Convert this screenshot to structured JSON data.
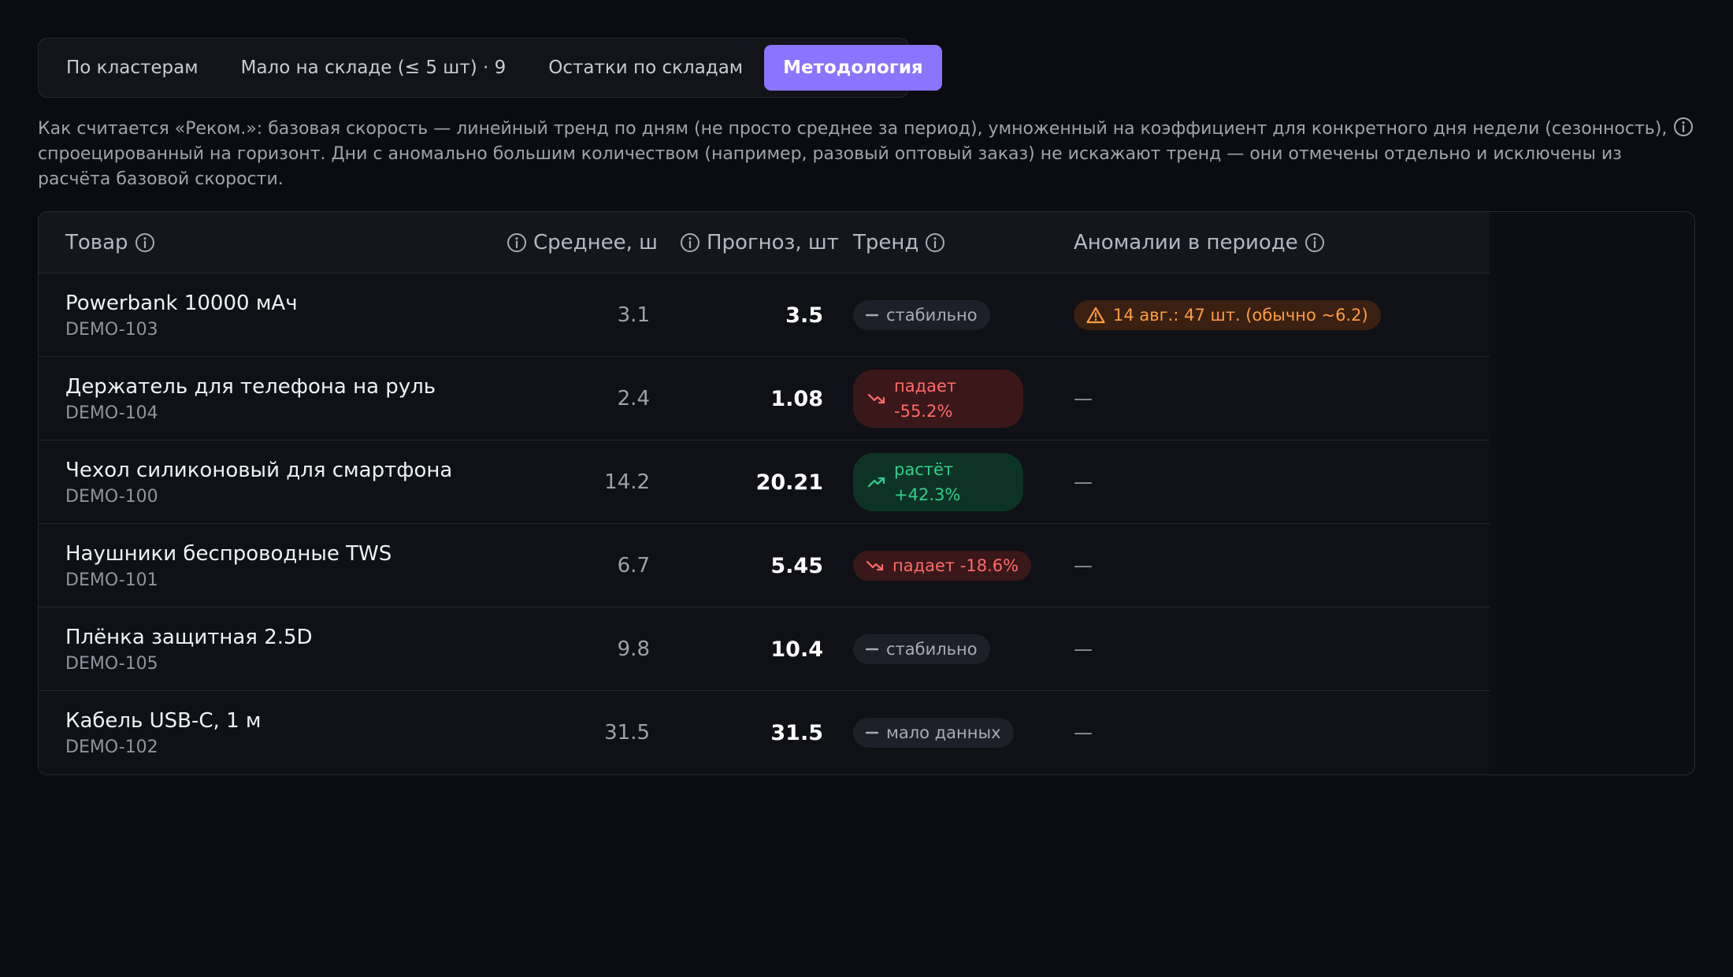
{
  "tabs": [
    {
      "label": "По кластерам",
      "active": false
    },
    {
      "label": "Мало на складе (≤ 5 шт) · 9",
      "active": false
    },
    {
      "label": "Остатки по складам",
      "active": false
    },
    {
      "label": "Методология",
      "active": true
    }
  ],
  "description": "Как считается «Реком.»: базовая скорость — линейный тренд по дням (не просто среднее за период), умноженный на коэффициент для конкретного дня недели (сезонность), спроецированный на горизонт. Дни с аномально большим количеством (например, разовый оптовый заказ) не искажают тренд — они отмечены отдельно и исключены из расчёта базовой скорости.",
  "table": {
    "headers": {
      "product": "Товар",
      "avg": "Среднее, ш",
      "forecast": "Прогноз, шт",
      "trend": "Тренд",
      "anomalies": "Аномалии в периоде"
    },
    "rows": [
      {
        "name": "Powerbank 10000 мАч",
        "sku": "DEMO-103",
        "avg": "3.1",
        "forecast": "3.5",
        "trend_type": "neutral",
        "trend_line1": "стабильно",
        "trend_line2": "",
        "anomaly": "14 авг.: 47 шт. (обычно ~6.2)",
        "has_anomaly": true
      },
      {
        "name": "Держатель для телефона на руль",
        "sku": "DEMO-104",
        "avg": "2.4",
        "forecast": "1.08",
        "trend_type": "down",
        "trend_line1": "падает",
        "trend_line2": "-55.2%",
        "anomaly": "—",
        "has_anomaly": false
      },
      {
        "name": "Чехол силиконовый для смартфона",
        "sku": "DEMO-100",
        "avg": "14.2",
        "forecast": "20.21",
        "trend_type": "up",
        "trend_line1": "растёт",
        "trend_line2": "+42.3%",
        "anomaly": "—",
        "has_anomaly": false
      },
      {
        "name": "Наушники беспроводные TWS",
        "sku": "DEMO-101",
        "avg": "6.7",
        "forecast": "5.45",
        "trend_type": "down",
        "trend_line1": "падает -18.6%",
        "trend_line2": "",
        "anomaly": "—",
        "has_anomaly": false
      },
      {
        "name": "Плёнка защитная 2.5D",
        "sku": "DEMO-105",
        "avg": "9.8",
        "forecast": "10.4",
        "trend_type": "neutral",
        "trend_line1": "стабильно",
        "trend_line2": "",
        "anomaly": "—",
        "has_anomaly": false
      },
      {
        "name": "Кабель USB-C, 1 м",
        "sku": "DEMO-102",
        "avg": "31.5",
        "forecast": "31.5",
        "trend_type": "neutral",
        "trend_line1": "мало данных",
        "trend_line2": "",
        "anomaly": "—",
        "has_anomaly": false
      }
    ]
  },
  "icons": {
    "info": "info-circle-icon",
    "trend_down": "trending-down-icon",
    "trend_up": "trending-up-icon",
    "neutral": "dash-icon",
    "warning": "warning-triangle-icon"
  },
  "colors": {
    "accent": "#8b74ff",
    "down": "#ff6b67",
    "up": "#31d08a",
    "warning": "#ff9d42"
  }
}
